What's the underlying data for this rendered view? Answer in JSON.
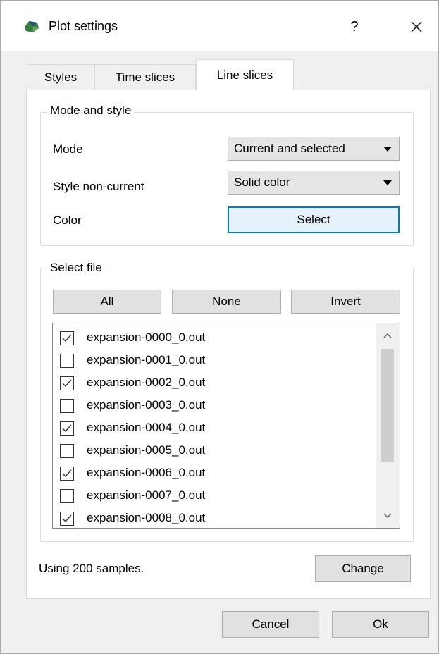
{
  "window": {
    "title": "Plot settings",
    "help_label": "?",
    "close_label": "✕"
  },
  "tabs": [
    {
      "label": "Styles",
      "active": false
    },
    {
      "label": "Time slices",
      "active": false
    },
    {
      "label": "Line slices",
      "active": true
    }
  ],
  "mode_and_style": {
    "group_title": "Mode and style",
    "mode_label": "Mode",
    "mode_value": "Current and selected",
    "style_label": "Style non-current",
    "style_value": "Solid color",
    "color_label": "Color",
    "color_button": "Select"
  },
  "select_file": {
    "group_title": "Select file",
    "all_button": "All",
    "none_button": "None",
    "invert_button": "Invert",
    "files": [
      {
        "name": "expansion-0000_0.out",
        "checked": true
      },
      {
        "name": "expansion-0001_0.out",
        "checked": false
      },
      {
        "name": "expansion-0002_0.out",
        "checked": true
      },
      {
        "name": "expansion-0003_0.out",
        "checked": false
      },
      {
        "name": "expansion-0004_0.out",
        "checked": true
      },
      {
        "name": "expansion-0005_0.out",
        "checked": false
      },
      {
        "name": "expansion-0006_0.out",
        "checked": true
      },
      {
        "name": "expansion-0007_0.out",
        "checked": false
      },
      {
        "name": "expansion-0008_0.out",
        "checked": true
      }
    ]
  },
  "samples": {
    "text": "Using 200 samples.",
    "change_button": "Change"
  },
  "footer": {
    "cancel_button": "Cancel",
    "ok_button": "Ok"
  },
  "icons": {
    "app": "plot-app-icon",
    "check": "checkmark-icon",
    "scroll_up": "chevron-up-icon",
    "scroll_down": "chevron-down-icon",
    "combo_arrow": "dropdown-arrow-icon"
  },
  "colors": {
    "accent": "#0078d7",
    "title_bar": "#ffffff",
    "dialog_bg": "#f0f0f0"
  }
}
